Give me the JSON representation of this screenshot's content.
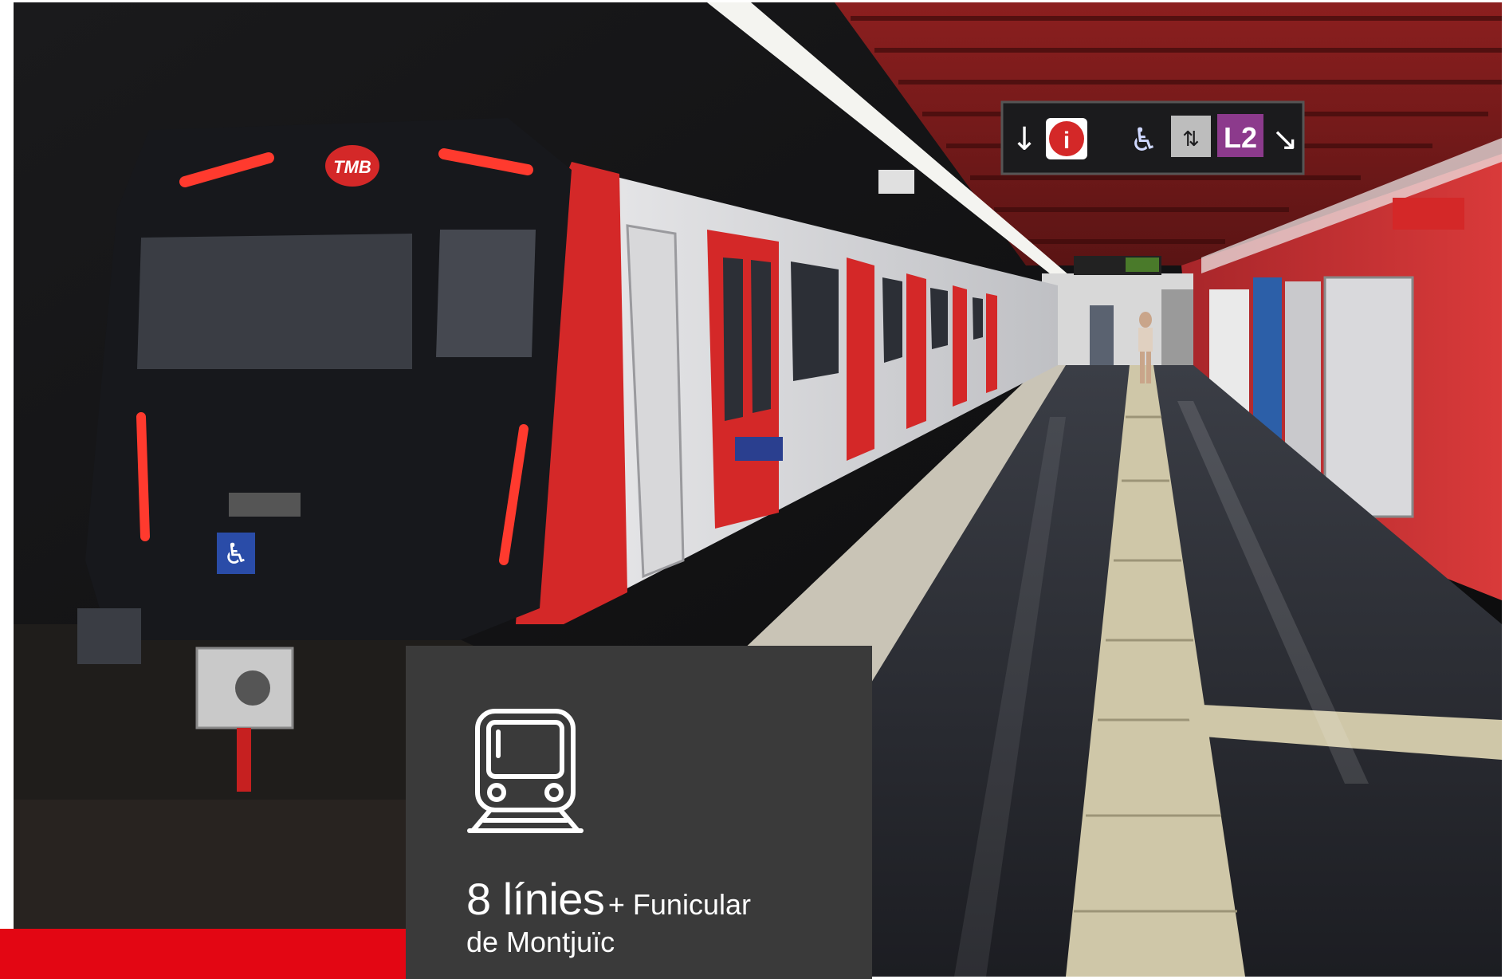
{
  "photo": {
    "description_icons": [
      "down-arrow-icon",
      "info-icon",
      "wheelchair-icon",
      "elevator-icon",
      "line-badge",
      "diagonal-arrow-icon"
    ],
    "sign": {
      "line_label": "L2",
      "info_glyph": "i"
    },
    "train_logo": "TMB"
  },
  "overlay": {
    "icon": "train-icon",
    "headline_number": "8 línies",
    "headline_suffix": "+ Funicular",
    "headline_line2": "de Montjuïc"
  },
  "colors": {
    "accent_red": "#e30613",
    "box_gray": "#3a3a3a",
    "text_white": "#ffffff"
  }
}
